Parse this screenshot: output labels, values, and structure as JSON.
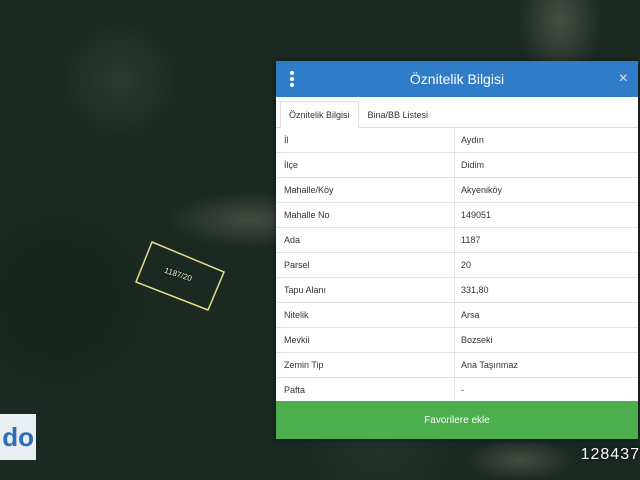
{
  "panel": {
    "title": "Öznitelik Bilgisi",
    "close_glyph": "×",
    "tabs": [
      {
        "label": "Öznitelik Bilgisi"
      },
      {
        "label": "Bina/BB Listesi"
      }
    ],
    "rows": [
      {
        "key": "İl",
        "value": "Aydın"
      },
      {
        "key": "İlçe",
        "value": "Didim"
      },
      {
        "key": "Mahalle/Köy",
        "value": "Akyeniköy"
      },
      {
        "key": "Mahalle No",
        "value": "149051"
      },
      {
        "key": "Ada",
        "value": "1187"
      },
      {
        "key": "Parsel",
        "value": "20"
      },
      {
        "key": "Tapu Alanı",
        "value": "331,80"
      },
      {
        "key": "Nitelik",
        "value": "Arsa"
      },
      {
        "key": "Mevkii",
        "value": "Bozseki"
      },
      {
        "key": "Zemin Tip",
        "value": "Ana Taşınmaz"
      },
      {
        "key": "Pafta",
        "value": "-"
      }
    ],
    "favorite_button": "Favorilere ekle"
  },
  "map": {
    "parcel_label": "1187/20",
    "parcel_outline_color": "#e8dc8c"
  },
  "logo_text": "do",
  "ad_number": "128437"
}
